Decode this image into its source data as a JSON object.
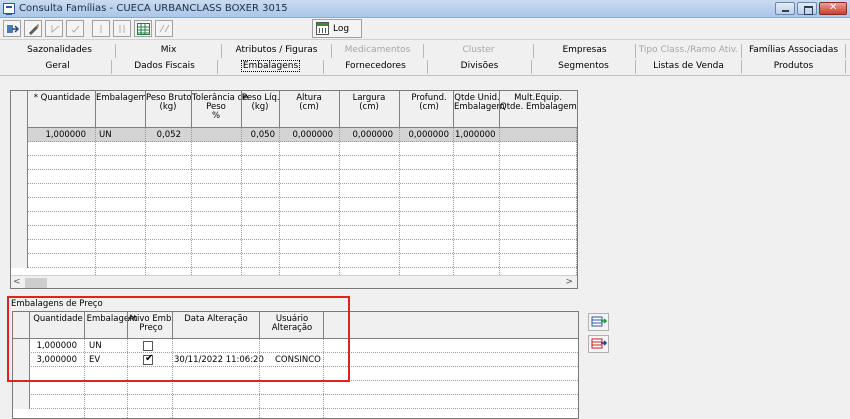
{
  "window": {
    "title": "Consulta Famílias - CUECA URBANCLASS BOXER 3015"
  },
  "toolbar": {
    "log_label": "Log"
  },
  "tabs_row1": [
    {
      "label": "Sazonalidades",
      "disabled": false
    },
    {
      "label": "Mix",
      "disabled": false
    },
    {
      "label": "Atributos / Figuras",
      "disabled": false
    },
    {
      "label": "Medicamentos",
      "disabled": true
    },
    {
      "label": "Cluster",
      "disabled": true
    },
    {
      "label": "Empresas",
      "disabled": false
    },
    {
      "label": "Tipo Class./Ramo Ativ.",
      "disabled": true
    },
    {
      "label": "Famílias Associadas",
      "disabled": false
    }
  ],
  "tabs_row2": [
    {
      "label": "Geral",
      "active": false
    },
    {
      "label": "Dados Fiscais",
      "active": false
    },
    {
      "label": "Embalagens",
      "active": true
    },
    {
      "label": "Fornecedores",
      "active": false
    },
    {
      "label": "Divisões",
      "active": false
    },
    {
      "label": "Segmentos",
      "active": false
    },
    {
      "label": "Listas de Venda",
      "active": false
    },
    {
      "label": "Produtos",
      "active": false
    }
  ],
  "embalagens_grid": {
    "columns": [
      {
        "label": "* Quantidade"
      },
      {
        "label": "Embalagem"
      },
      {
        "label": "Peso Bruto\n(kg)"
      },
      {
        "label": "Tolerância de\nPeso\n%"
      },
      {
        "label": "Peso Líq.\n(kg)"
      },
      {
        "label": "Altura\n(cm)"
      },
      {
        "label": "Largura\n(cm)"
      },
      {
        "label": "Profund.\n(cm)"
      },
      {
        "label": "Qtde Unid.\nEmbalagem"
      },
      {
        "label": "Mult.Equip.\nQtde. Embalagem"
      }
    ],
    "rows": [
      [
        "1,000000",
        "UN",
        "0,052",
        "",
        "0,050",
        "0,000000",
        "0,000000",
        "0,000000",
        "1,000000",
        ""
      ]
    ]
  },
  "precos_group": {
    "title": "Embalagens de Preço",
    "columns": [
      {
        "label": "Quantidade"
      },
      {
        "label": "Embalagem"
      },
      {
        "label": "Ativo Emb.\nPreço"
      },
      {
        "label": "Data Alteração"
      },
      {
        "label": "Usuário\nAlteração"
      }
    ],
    "rows": [
      {
        "quantidade": "1,000000",
        "embalagem": "UN",
        "ativo": false,
        "data": "",
        "usuario": ""
      },
      {
        "quantidade": "3,000000",
        "embalagem": "EV",
        "ativo": true,
        "data": "30/11/2022 11:06:20",
        "usuario": "CONSINCO"
      }
    ]
  }
}
